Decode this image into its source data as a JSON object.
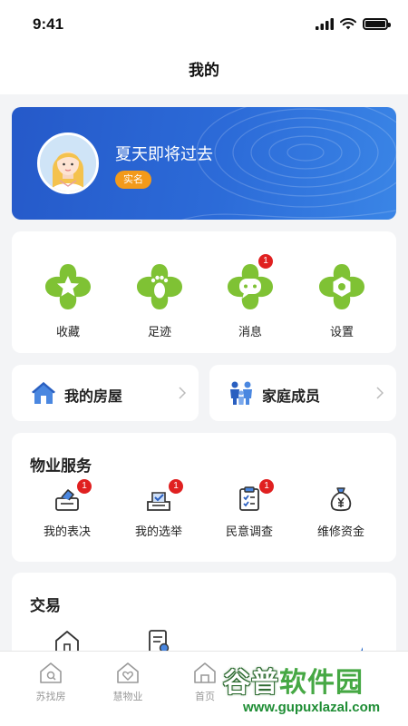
{
  "status_bar": {
    "time": "9:41"
  },
  "nav": {
    "title": "我的"
  },
  "profile": {
    "name": "夏天即将过去",
    "badge": "实名"
  },
  "quick_actions": [
    {
      "label": "收藏",
      "icon": "star-icon"
    },
    {
      "label": "足迹",
      "icon": "footprint-icon"
    },
    {
      "label": "消息",
      "icon": "message-icon",
      "badge": "1"
    },
    {
      "label": "设置",
      "icon": "gear-icon"
    }
  ],
  "links": {
    "house": {
      "label": "我的房屋",
      "icon": "house-icon"
    },
    "family": {
      "label": "家庭成员",
      "icon": "family-icon"
    }
  },
  "property_service": {
    "title": "物业服务",
    "items": [
      {
        "label": "我的表决",
        "icon": "vote-box-icon",
        "badge": "1"
      },
      {
        "label": "我的选举",
        "icon": "ballot-icon",
        "badge": "1"
      },
      {
        "label": "民意调查",
        "icon": "survey-icon",
        "badge": "1"
      },
      {
        "label": "维修资金",
        "icon": "money-bag-icon"
      }
    ]
  },
  "trade": {
    "title": "交易"
  },
  "tab_bar": {
    "items": [
      {
        "label": "苏找房",
        "icon": "house-search-icon"
      },
      {
        "label": "慧物业",
        "icon": "heart-house-icon"
      },
      {
        "label": "首页",
        "icon": "home-icon"
      }
    ]
  },
  "watermark": {
    "part1": "谷普",
    "part2": "软件园",
    "url": "www.gupuxlazal.com"
  },
  "colors": {
    "primary": "#2559c9",
    "accent_green": "#7fc234",
    "badge_red": "#e02020",
    "badge_orange": "#f29a1b"
  }
}
